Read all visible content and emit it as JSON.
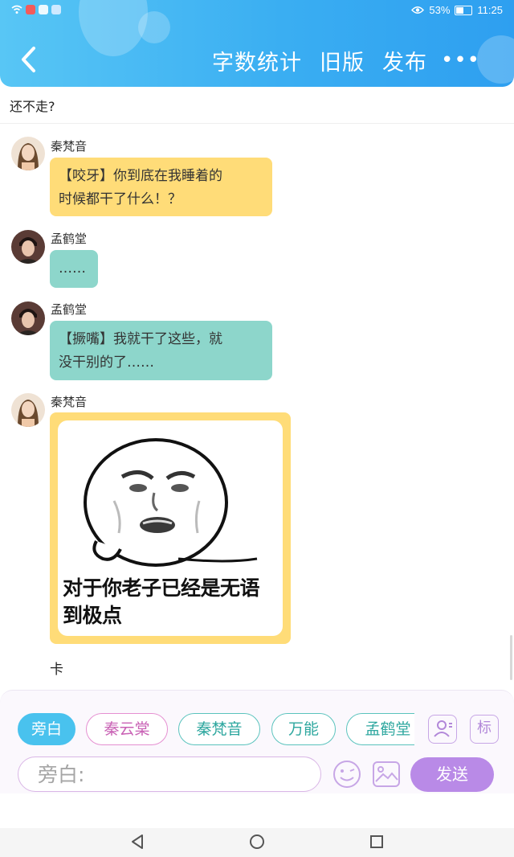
{
  "status": {
    "battery": "53%",
    "time": "11:25"
  },
  "header": {
    "actions": [
      "字数统计",
      "旧版",
      "发布"
    ],
    "more": "•••"
  },
  "subtitle": "还不走?",
  "messages": [
    {
      "speaker": "秦梵音",
      "text_lines": [
        "【咬牙】你到底在我睡着的",
        "时候都干了什么！？"
      ],
      "color": "#ffdc78"
    },
    {
      "speaker": "孟鹤堂",
      "text_lines": [
        "……"
      ],
      "color": "#8dd6cb"
    },
    {
      "speaker": "孟鹤堂",
      "text_lines": [
        "【撅嘴】我就干了这些，就",
        "没干别的了……"
      ],
      "color": "#8dd6cb"
    },
    {
      "speaker": "秦梵音",
      "sticker_caption_lines": [
        "对于你老子已经是无语",
        "到极点"
      ],
      "color": "#ffdc78"
    }
  ],
  "trailing_text": "卡",
  "composer": {
    "roles": [
      "旁白",
      "秦云棠",
      "秦梵音",
      "万能",
      "孟鹤堂"
    ],
    "active_role": "旁白",
    "tag_button": "标",
    "input_placeholder": "旁白:",
    "send_label": "发送"
  },
  "colors": {
    "header_blue": "#3aaef2",
    "yellow_bubble": "#ffdc78",
    "teal_bubble": "#8dd6cb",
    "send_purple": "#b98ae7",
    "active_chip": "#49c2ee"
  }
}
